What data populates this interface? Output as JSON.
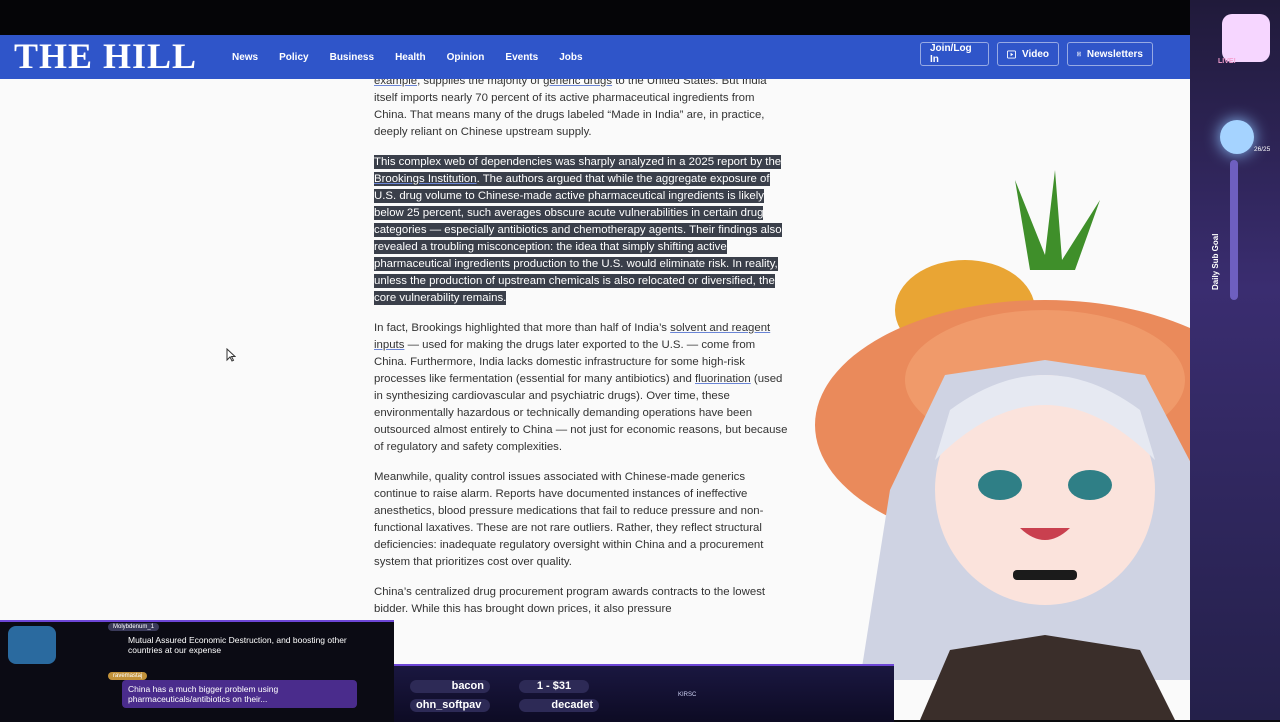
{
  "site": {
    "logo": "THE HILL",
    "nav": [
      "News",
      "Policy",
      "Business",
      "Health",
      "Opinion",
      "Events",
      "Jobs"
    ],
    "join_label": "Join/Log In",
    "video_label": "Video",
    "newsletters_label": "Newsletters"
  },
  "article": {
    "p1": {
      "a": "example",
      "b": ", supplies the majority of ",
      "c": "generic drugs",
      "d": " to the United States. But India itself imports nearly 70 percent of its active pharmaceutical ingredients from China. That means many of the drugs labeled “Made in India” are, in practice, deeply reliant on Chinese upstream supply."
    },
    "p2": {
      "a": "This complex web of dependencies was sharply analyzed in a 2025 report by the ",
      "b": "Brookings Institution",
      "c": ". The authors argued that while the aggregate exposure of U.S. drug volume to Chinese-made active pharmaceutical ingredients is likely below 25 percent, such averages obscure acute vulnerabilities in certain drug categories — especially antibiotics and chemotherapy agents. Their findings also revealed a troubling misconception: the idea that simply shifting active pharmaceutical ingredients production to the U.S. would eliminate risk. In reality, unless the production of upstream chemicals is also relocated or diversified, the core vulnerability remains."
    },
    "p3": {
      "a": "In fact, Brookings highlighted that more than half of India’s ",
      "b": "solvent and reagent inputs",
      "c": " — used for making the drugs later exported to the U.S. — come from China. Furthermore, India lacks domestic infrastructure for some high-risk processes like fermentation (essential for many antibiotics) and ",
      "d": "fluorination",
      "e": " (used in synthesizing cardiovascular and psychiatric drugs). Over time, these environmentally hazardous or technically demanding operations have been outsourced almost entirely to China — not just for economic reasons, but because of regulatory and safety complexities."
    },
    "p4": "Meanwhile, quality control issues associated with Chinese-made generics continue to raise alarm. Reports have documented instances of ineffective anesthetics, blood pressure medications that fail to reduce pressure and non-functional laxatives. These are not rare outliers. Rather, they reflect structural deficiencies: inadequate regulatory oversight within China and a procurement system that prioritizes cost over quality.",
    "p5": "China’s centralized drug procurement program awards contracts to the lowest bidder. While this has brought down prices, it also pressure"
  },
  "chat": [
    {
      "user": "Molybdenum_1",
      "message": "Mutual Assured Economic Destruction, and boosting other countries at our expense"
    },
    {
      "user": "ravemastaj",
      "message": "China has a much bigger problem using pharmaceuticals/antibiotics on their..."
    }
  ],
  "ticker": {
    "items": [
      "bacon",
      "1 - $31",
      "ohn_softpav",
      "decadet",
      "KIRSC"
    ]
  },
  "overlay": {
    "live_label": "LIVE!",
    "sub_goal_label": "Daily Sub Goal",
    "sub_count": "26/25"
  },
  "colors": {
    "nav": "#2f55c9",
    "highlight": "#3a3f4a",
    "overlay": "#3a2d70"
  }
}
